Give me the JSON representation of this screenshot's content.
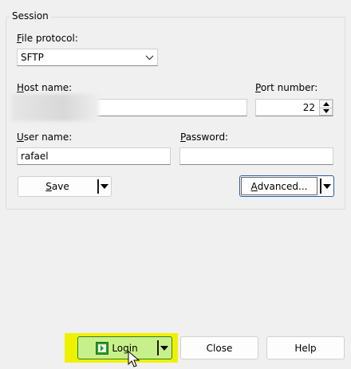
{
  "session": {
    "legend": "Session",
    "protocol": {
      "label": "File protocol:",
      "label_key": "F",
      "label_rest": "ile protocol:",
      "value": "SFTP"
    },
    "host": {
      "label_key": "H",
      "label_rest": "ost name:",
      "value": ""
    },
    "port": {
      "label_key": "P",
      "label_rest": "ort number:",
      "value": "22"
    },
    "user": {
      "label_key": "U",
      "label_rest": "ser name:",
      "value": "rafael"
    },
    "password": {
      "label_key": "P",
      "label_rest": "assword:",
      "value": ""
    },
    "save": {
      "label_key": "S",
      "label_rest": "ave"
    },
    "advanced": {
      "label_key": "A",
      "label_rest": "dvanced..."
    }
  },
  "footer": {
    "login": "Login",
    "close": "Close",
    "help": "Help"
  },
  "colors": {
    "highlight": "#eef200",
    "login_bg": "#c8f08a",
    "focus_border": "#2a5aa8"
  }
}
